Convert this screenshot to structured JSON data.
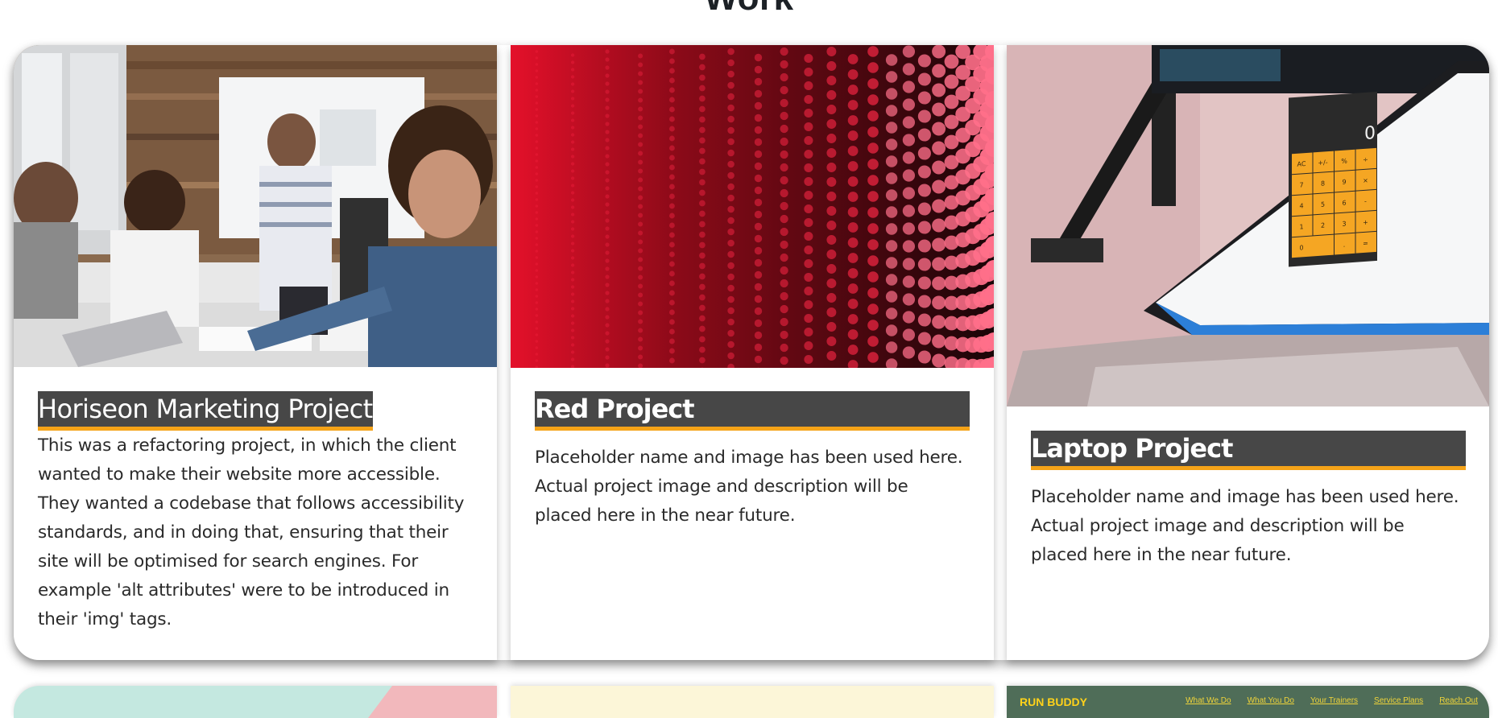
{
  "section": {
    "title": "Work"
  },
  "projects": [
    {
      "title": "Horiseon Marketing Project",
      "description": "This was a refactoring project, in which the client wanted to make their website more accessible. They wanted a codebase that follows accessibility standards, and in doing that, ensuring that their site will be optimised for search engines. For example 'alt attributes' were to be introduced in their 'img' tags."
    },
    {
      "title": "Red Project",
      "description": "Placeholder name and image has been used here. Actual project image and description will be placed here in the near future."
    },
    {
      "title": "Laptop Project",
      "description": "Placeholder name and image has been used here. Actual project image and description will be placed here in the near future."
    }
  ],
  "photo_text": {
    "calculator_display": "0",
    "calculator_keys": [
      "AC",
      "+/-",
      "%",
      "÷",
      "7",
      "8",
      "9",
      "×",
      "4",
      "5",
      "6",
      "-",
      "1",
      "2",
      "3",
      "+",
      "0",
      ".",
      "="
    ]
  },
  "next_row": {
    "run_buddy": {
      "brand": "RUN BUDDY",
      "nav": [
        "What We Do",
        "What You Do",
        "Your Trainers",
        "Service Plans",
        "Reach Out"
      ]
    }
  },
  "colors": {
    "title_bg": "#474747",
    "title_underline": "#f5a318",
    "text": "#2a2a2a",
    "heading": "#1c2126"
  }
}
